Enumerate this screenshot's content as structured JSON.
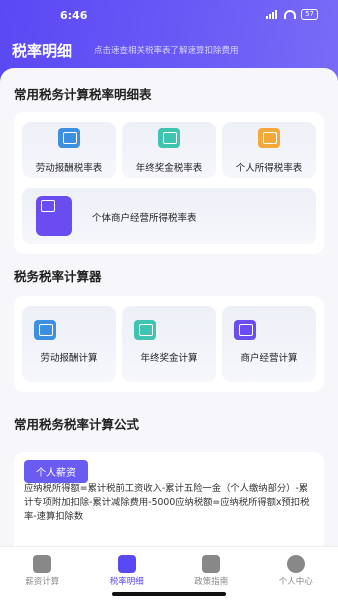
{
  "status": {
    "time": "6:46",
    "battery": "57"
  },
  "header": {
    "title": "税率明细",
    "subtitle": "点击速查相关税率表了解速算扣除费用"
  },
  "sections": {
    "tables_title": "常用税务计算税率明细表",
    "calculators_title": "税务税率计算器",
    "formulas_title": "常用税务税率计算公式"
  },
  "tables": [
    {
      "label": "劳动报酬税率表",
      "icon": "labor-rate-icon"
    },
    {
      "label": "年终奖金税率表",
      "icon": "bonus-rate-icon"
    },
    {
      "label": "个人所得税率表",
      "icon": "income-tax-icon"
    },
    {
      "label": "个体商户经营所得税率表",
      "icon": "merchant-icon"
    }
  ],
  "calculators": [
    {
      "label": "劳动报酬计算",
      "icon": "labor-calc-icon"
    },
    {
      "label": "年终奖金计算",
      "icon": "bonus-calc-icon"
    },
    {
      "label": "商户经营计算",
      "icon": "merchant-calc-icon"
    }
  ],
  "formula": {
    "badge": "个人薪资",
    "text": "应纳税所得额=累计税前工资收入-累计五险一金（个人缴纳部分）-累计专项附加扣除-累计减除费用-5000应纳税额=应纳税所得额x预扣税率-速算扣除数"
  },
  "tabbar": [
    {
      "label": "薪资计算",
      "icon": "salary-calc-icon"
    },
    {
      "label": "税率明细",
      "icon": "tax-detail-icon"
    },
    {
      "label": "政策指南",
      "icon": "policy-book-icon"
    },
    {
      "label": "个人中心",
      "icon": "user-icon"
    }
  ],
  "colors": {
    "primary": "#5a48f4",
    "blue": "#3d8fe0",
    "teal": "#3ec4b0",
    "orange": "#f5a83a",
    "purple": "#6a4cf0"
  }
}
